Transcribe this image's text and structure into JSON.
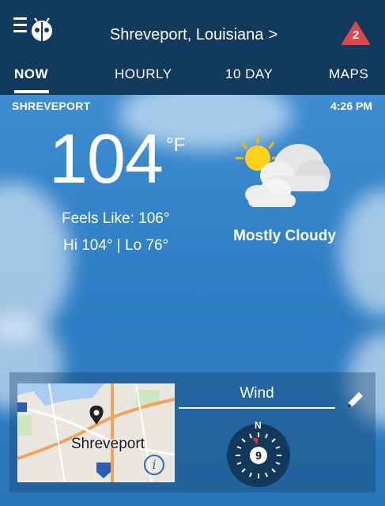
{
  "header": {
    "location": "Shreveport, Louisiana",
    "chevron": ">",
    "alert_count": "2"
  },
  "tabs": [
    {
      "label": "NOW",
      "active": true
    },
    {
      "label": "HOURLY",
      "active": false
    },
    {
      "label": "10 DAY",
      "active": false
    },
    {
      "label": "MAPS",
      "active": false
    }
  ],
  "current": {
    "city": "SHREVEPORT",
    "time": "4:26 PM",
    "temperature": "104",
    "unit": "°F",
    "feels_like": "Feels Like: 106°",
    "hi_lo": "Hi 104° | Lo 76°",
    "condition": "Mostly Cloudy",
    "condition_icon": "partly-cloudy-icon"
  },
  "card": {
    "map_city_label": "Shreveport",
    "map_info": "i",
    "wind_title": "Wind",
    "compass_north": "N",
    "wind_speed": "9"
  },
  "colors": {
    "header_bg": "#123a5c",
    "alert_red": "#e04848",
    "sky_blue": "#2f7cc0"
  }
}
